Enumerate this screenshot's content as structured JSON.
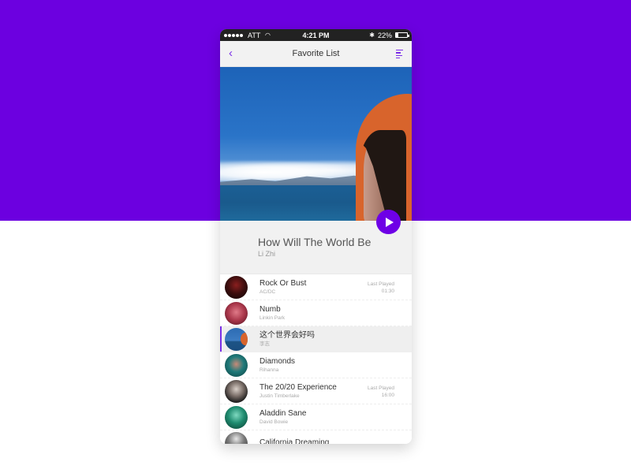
{
  "status_bar": {
    "carrier": "ATT",
    "time": "4:21 PM",
    "battery": "22%",
    "battery_level": 0.22,
    "icons": [
      "signal-dots-icon",
      "wifi-icon",
      "bluetooth-icon",
      "battery-icon"
    ]
  },
  "nav": {
    "back_icon": "‹",
    "title": "Favorite List",
    "menu_icon": "menu-lines-icon"
  },
  "now_playing": {
    "title": "How Will The World Be",
    "artist": "Li Zhi",
    "play_icon": "play-icon"
  },
  "colors": {
    "accent": "#6e00e6",
    "background_top": "#6c00e0",
    "selected_row": "#efefef"
  },
  "songs": [
    {
      "title": "Rock Or Bust",
      "artist": "AC/DC",
      "meta_label": "Last Played",
      "meta_value": "01:30",
      "selected": false
    },
    {
      "title": "Numb",
      "artist": "Linkin Park",
      "meta_label": "",
      "meta_value": "",
      "selected": false
    },
    {
      "title": "这个世界会好吗",
      "artist": "李志",
      "meta_label": "",
      "meta_value": "",
      "selected": true
    },
    {
      "title": "Diamonds",
      "artist": "Rihanna",
      "meta_label": "",
      "meta_value": "",
      "selected": false
    },
    {
      "title": "The 20/20 Experience",
      "artist": "Justin Timberlake",
      "meta_label": "Last Played",
      "meta_value": "16:00",
      "selected": false
    },
    {
      "title": "Aladdin Sane",
      "artist": "David Bowie",
      "meta_label": "",
      "meta_value": "",
      "selected": false
    },
    {
      "title": "California Dreaming",
      "artist": "",
      "meta_label": "",
      "meta_value": "",
      "selected": false
    }
  ]
}
